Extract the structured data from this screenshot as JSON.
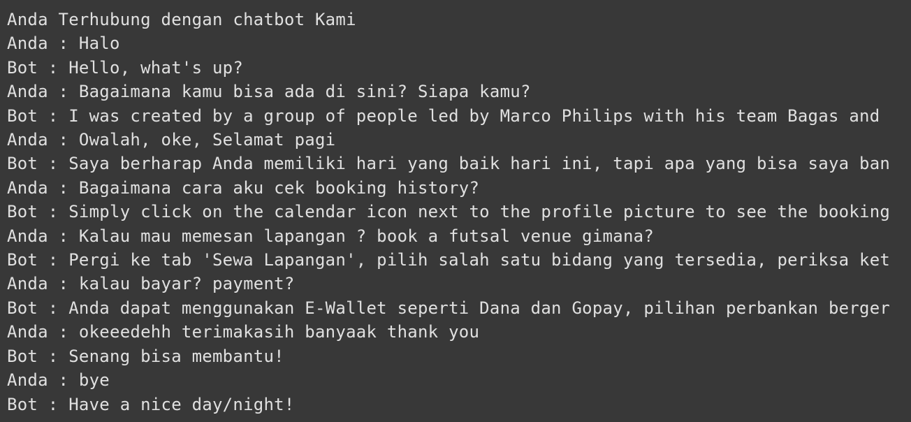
{
  "console": {
    "lines": [
      "Anda Terhubung dengan chatbot Kami",
      "Anda : Halo",
      "Bot : Hello, what's up?",
      "Anda : Bagaimana kamu bisa ada di sini? Siapa kamu?",
      "Bot : I was created by a group of people led by Marco Philips with his team Bagas and",
      "Anda : Owalah, oke, Selamat pagi",
      "Bot : Saya berharap Anda memiliki hari yang baik hari ini, tapi apa yang bisa saya ban",
      "Anda : Bagaimana cara aku cek booking history?",
      "Bot : Simply click on the calendar icon next to the profile picture to see the booking",
      "Anda : Kalau mau memesan lapangan ? book a futsal venue gimana?",
      "Bot : Pergi ke tab 'Sewa Lapangan', pilih salah satu bidang yang tersedia, periksa ket",
      "Anda : kalau bayar? payment?",
      "Bot : Anda dapat menggunakan E-Wallet seperti Dana dan Gopay, pilihan perbankan berger",
      "Anda : okeeedehh terimakasih banyaak thank you",
      "Bot : Senang bisa membantu!",
      "Anda : bye",
      "Bot : Have a nice day/night!"
    ]
  },
  "colors": {
    "background": "#383838",
    "text": "#e0e0e0"
  }
}
